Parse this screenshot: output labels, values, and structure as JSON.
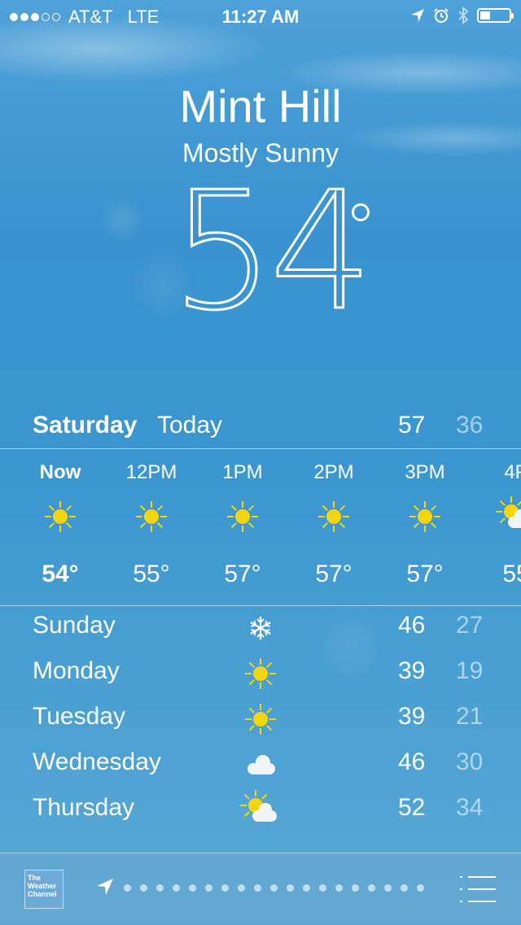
{
  "status_bar": {
    "carrier": "AT&T",
    "network": "LTE",
    "time": "11:27 AM",
    "signal_bars_filled": 3,
    "signal_bars_total": 5,
    "battery_level": 0.35
  },
  "header": {
    "city": "Mint Hill",
    "condition": "Mostly Sunny",
    "temperature": "54"
  },
  "today": {
    "day": "Saturday",
    "label": "Today",
    "high": "57",
    "low": "36"
  },
  "hourly": [
    {
      "hour": "Now",
      "icon": "sun-icon",
      "temp": "54°"
    },
    {
      "hour": "12PM",
      "icon": "sun-icon",
      "temp": "55°"
    },
    {
      "hour": "1PM",
      "icon": "sun-icon",
      "temp": "57°"
    },
    {
      "hour": "2PM",
      "icon": "sun-icon",
      "temp": "57°"
    },
    {
      "hour": "3PM",
      "icon": "sun-icon",
      "temp": "57°"
    },
    {
      "hour": "4P",
      "icon": "partly-cloudy-icon",
      "temp": "55"
    }
  ],
  "daily": [
    {
      "day": "Sunday",
      "icon": "snowflake-icon",
      "high": "46",
      "low": "27"
    },
    {
      "day": "Monday",
      "icon": "sun-icon",
      "high": "39",
      "low": "19"
    },
    {
      "day": "Tuesday",
      "icon": "sun-icon",
      "high": "39",
      "low": "21"
    },
    {
      "day": "Wednesday",
      "icon": "cloud-icon",
      "high": "46",
      "low": "30"
    },
    {
      "day": "Thursday",
      "icon": "partly-cloudy-icon",
      "high": "52",
      "low": "34"
    }
  ],
  "bottom_bar": {
    "logo_text": "The Weather Channel",
    "page_count": 19,
    "current_page": "location"
  },
  "colors": {
    "sun": "#f5d60e",
    "sky": "#3b96cf"
  }
}
